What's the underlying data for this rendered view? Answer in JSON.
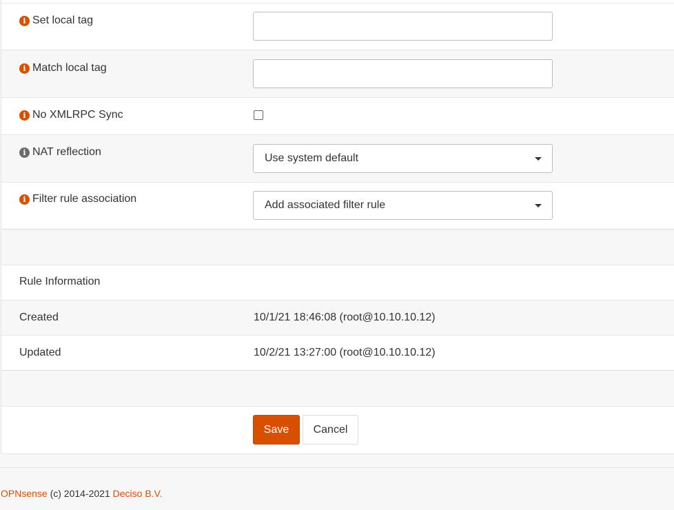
{
  "form": {
    "set_local_tag": {
      "label": "Set local tag",
      "value": ""
    },
    "match_local_tag": {
      "label": "Match local tag",
      "value": ""
    },
    "no_xmlrpc_sync": {
      "label": "No XMLRPC Sync",
      "checked": false
    },
    "nat_reflection": {
      "label": "NAT reflection",
      "selected": "Use system default"
    },
    "filter_rule_association": {
      "label": "Filter rule association",
      "selected": "Add associated filter rule"
    }
  },
  "rule_info": {
    "heading": "Rule Information",
    "created_label": "Created",
    "created_value": "10/1/21 18:46:08 (root@10.10.10.12)",
    "updated_label": "Updated",
    "updated_value": "10/2/21 13:27:00 (root@10.10.10.12)"
  },
  "actions": {
    "save_label": "Save",
    "cancel_label": "Cancel"
  },
  "footer": {
    "brand": "OPNsense",
    "copyright": " (c) 2014-2021 ",
    "company": "Deciso B.V."
  },
  "icons": {
    "info": "info-circle-icon",
    "caret": "caret-down-icon"
  },
  "colors": {
    "accent": "#d94f00",
    "info_gray": "#6b6b6b"
  }
}
